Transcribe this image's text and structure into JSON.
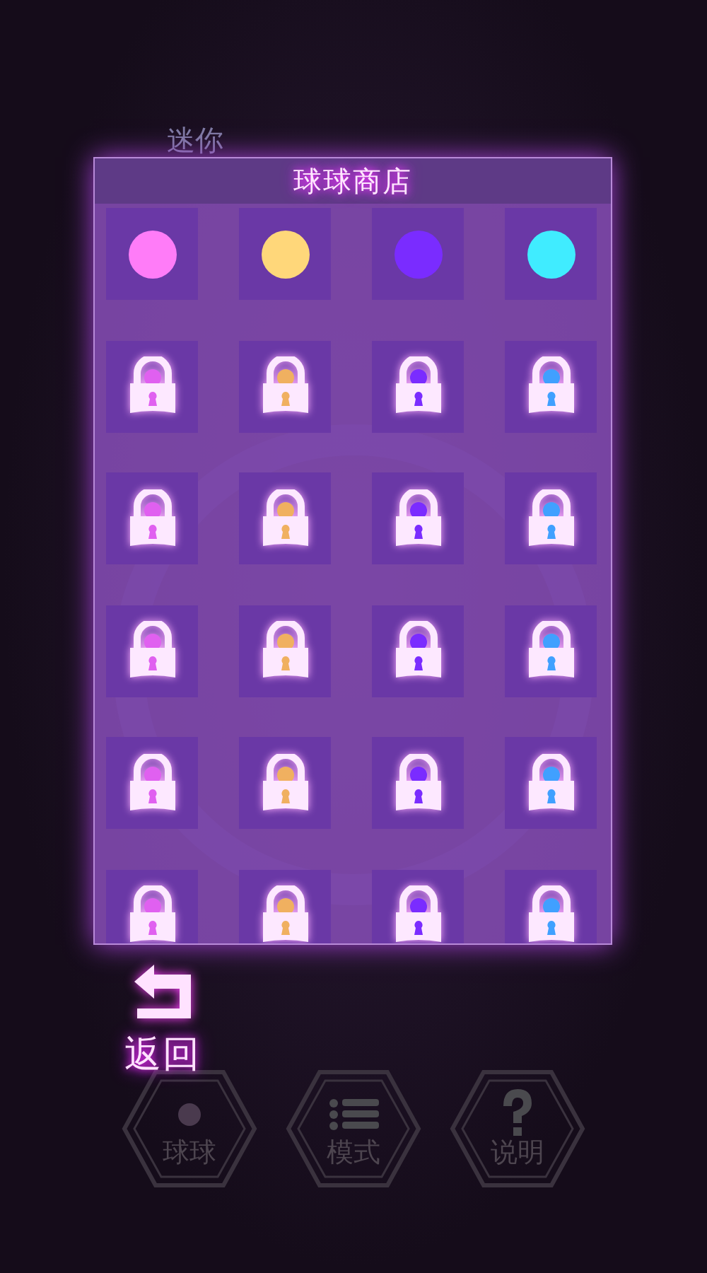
{
  "background": {
    "title": "迷你"
  },
  "shop": {
    "title": "球球商店",
    "items": [
      {
        "kind": "ball",
        "color": "#ff7cf8"
      },
      {
        "kind": "ball",
        "color": "#ffd77a"
      },
      {
        "kind": "ball",
        "color": "#7a2cff"
      },
      {
        "kind": "ball",
        "color": "#40ecff"
      },
      {
        "kind": "locked",
        "color": "#e060f0"
      },
      {
        "kind": "locked",
        "color": "#f0b060"
      },
      {
        "kind": "locked",
        "color": "#7a2cff"
      },
      {
        "kind": "locked",
        "color": "#40a0ff"
      },
      {
        "kind": "locked",
        "color": "#e060f0"
      },
      {
        "kind": "locked",
        "color": "#f0b060"
      },
      {
        "kind": "locked",
        "color": "#7a2cff"
      },
      {
        "kind": "locked",
        "color": "#40a0ff"
      },
      {
        "kind": "locked",
        "color": "#e060f0"
      },
      {
        "kind": "locked",
        "color": "#f0b060"
      },
      {
        "kind": "locked",
        "color": "#7a2cff"
      },
      {
        "kind": "locked",
        "color": "#40a0ff"
      },
      {
        "kind": "locked",
        "color": "#e060f0"
      },
      {
        "kind": "locked",
        "color": "#f0b060"
      },
      {
        "kind": "locked",
        "color": "#7a2cff"
      },
      {
        "kind": "locked",
        "color": "#40a0ff"
      },
      {
        "kind": "locked",
        "color": "#e060f0"
      },
      {
        "kind": "locked",
        "color": "#f0b060"
      },
      {
        "kind": "locked",
        "color": "#7a2cff"
      },
      {
        "kind": "locked",
        "color": "#40a0ff"
      }
    ]
  },
  "back_button": {
    "label": "返回"
  },
  "menu": [
    {
      "kind": "ball",
      "label": "球球"
    },
    {
      "kind": "list",
      "label": "模式"
    },
    {
      "kind": "help",
      "label": "说明"
    }
  ]
}
